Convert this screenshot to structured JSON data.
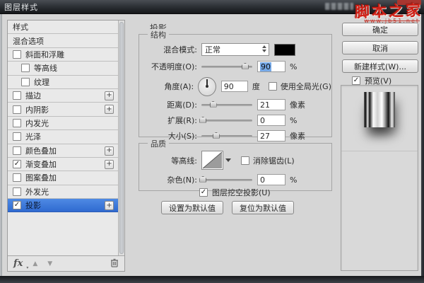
{
  "window": {
    "title": "图层样式"
  },
  "watermark": {
    "site": "脚本之家",
    "url": "www.jb51.net"
  },
  "sidebar": {
    "items": [
      {
        "label": "样式",
        "checkbox": false,
        "checked": false
      },
      {
        "label": "混合选项",
        "checkbox": false,
        "checked": false
      },
      {
        "label": "斜面和浮雕",
        "checkbox": true,
        "checked": false
      },
      {
        "label": "等高线",
        "checkbox": true,
        "checked": false,
        "indent": true
      },
      {
        "label": "纹理",
        "checkbox": true,
        "checked": false,
        "indent": true
      },
      {
        "label": "描边",
        "checkbox": true,
        "checked": false,
        "plus": true
      },
      {
        "label": "内阴影",
        "checkbox": true,
        "checked": false,
        "plus": true
      },
      {
        "label": "内发光",
        "checkbox": true,
        "checked": false
      },
      {
        "label": "光泽",
        "checkbox": true,
        "checked": false
      },
      {
        "label": "颜色叠加",
        "checkbox": true,
        "checked": false,
        "plus": true
      },
      {
        "label": "渐变叠加",
        "checkbox": true,
        "checked": true,
        "plus": true
      },
      {
        "label": "图案叠加",
        "checkbox": true,
        "checked": false
      },
      {
        "label": "外发光",
        "checkbox": true,
        "checked": false
      },
      {
        "label": "投影",
        "checkbox": true,
        "checked": true,
        "plus": true,
        "selected": true
      }
    ],
    "footer": {
      "fx_label": "fx"
    }
  },
  "panel": {
    "title": "投影",
    "structure": {
      "label": "结构",
      "blend_mode_label": "混合模式:",
      "blend_mode_value": "正常",
      "swatch_color": "#000000",
      "opacity_label": "不透明度(O):",
      "opacity_value": "90",
      "opacity_unit": "%",
      "angle_label": "角度(A):",
      "angle_value": "90",
      "angle_unit": "度",
      "global_light_label": "使用全局光(G)",
      "global_light_checked": false,
      "distance_label": "距离(D):",
      "distance_value": "21",
      "distance_unit": "像素",
      "spread_label": "扩展(R):",
      "spread_value": "0",
      "spread_unit": "%",
      "size_label": "大小(S):",
      "size_value": "27",
      "size_unit": "像素"
    },
    "quality": {
      "label": "品质",
      "contour_label": "等高线:",
      "antialias_label": "消除锯齿(L)",
      "antialias_checked": false,
      "noise_label": "杂色(N):",
      "noise_value": "0",
      "noise_unit": "%"
    },
    "knockout_label": "图层挖空投影(U)",
    "knockout_checked": true,
    "make_default": "设置为默认值",
    "reset_default": "复位为默认值"
  },
  "actions": {
    "ok": "确定",
    "cancel": "取消",
    "new_style": "新建样式(W)...",
    "preview_label": "预览(V)",
    "preview_checked": true
  }
}
